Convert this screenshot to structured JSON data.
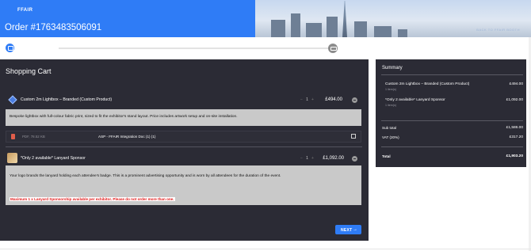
{
  "header": {
    "brand": "FFAIR",
    "order_title": "Order #1763483506091",
    "back_link": "BACK TO FFAIR BOOTH"
  },
  "cart": {
    "title": "Shopping Cart",
    "items": [
      {
        "name": "Custom 2m Lightbox – Branded (Custom Product)",
        "qty": "1",
        "price": "£494.00",
        "description": "Bespoke lightbox with full-colour fabric print, sized to fit the exhibitor's stand layout. Price includes artwork setup and on-site installation.",
        "file": {
          "meta": "PDF, 78.52 KB",
          "name": "ASP - FFAIR Integration Doc (1) (1)"
        }
      },
      {
        "name": "*Only 2 available* Lanyard Sponsor",
        "qty": "1",
        "price": "£1,092.00",
        "description": "Your logo brands the lanyard holding each attendee's badge. This is a prominent advertising opportunity and is worn by all attendees for the duration of the event.",
        "warning": "Maximum 1 x Lanyard Sponsorship available per exhibitor. Please do not order more than one."
      }
    ],
    "next_label": "NEXT",
    "next_arrow": "→"
  },
  "summary": {
    "title": "Summary",
    "items": [
      {
        "name": "Custom 2m Lightbox – Branded (Custom Product)",
        "sub": "1 item(s)",
        "price": "£494.00"
      },
      {
        "name": "*Only 2 available* Lanyard Sponsor",
        "sub": "1 item(s)",
        "price": "£1,092.00"
      }
    ],
    "subtotal_label": "Sub total",
    "subtotal": "£1,586.00",
    "vat_label": "VAT (20%)",
    "vat": "£317.20",
    "total_label": "Total",
    "total": "£1,903.20"
  },
  "colors": {
    "accent": "#2f7cf6",
    "panel": "#2b2b35",
    "warning": "#e21a1a"
  }
}
